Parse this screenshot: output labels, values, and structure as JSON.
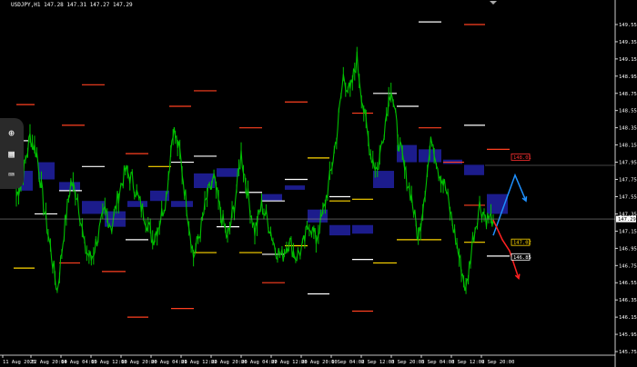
{
  "symbol_line": "USDJPY,H1  147.28 147.31 147.27 147.29",
  "colors": {
    "background": "#000000",
    "candles": "#00c000",
    "axis": "#ffffff",
    "blue_box": "#1c1c8c",
    "blue_arrow": "#1e90ff",
    "red_arrow": "#ff2020"
  },
  "toolbar": [
    {
      "name": "zoom-icon",
      "glyph": "⊕"
    },
    {
      "name": "grid-icon",
      "glyph": "▦"
    },
    {
      "name": "keyboard-icon",
      "glyph": "⌨"
    }
  ],
  "chart_data": {
    "type": "line",
    "title": "",
    "xlabel": "",
    "ylabel": "",
    "price_labels": [
      "149.55",
      "149.35",
      "149.15",
      "148.95",
      "148.75",
      "148.55",
      "148.35",
      "148.15",
      "147.95",
      "147.75",
      "147.55",
      "147.35",
      "147.15",
      "146.95",
      "146.75",
      "146.55",
      "146.35",
      "146.15",
      "145.95",
      "145.75"
    ],
    "price_range": [
      145.7,
      149.6
    ],
    "time_labels": [
      "11 Aug 2025",
      "12 Aug 20:00",
      "14 Aug 04:00",
      "15 Aug 12:00",
      "18 Aug 20:00",
      "20 Aug 04:00",
      "21 Aug 12:00",
      "22 Aug 20:00",
      "26 Aug 04:00",
      "27 Aug 12:00",
      "28 Aug 20:00",
      "1 Sep 04:00",
      "2 Sep 12:00",
      "3 Sep 20:00",
      "5 Sep 04:00",
      "8 Sep 12:00",
      "9 Sep 20:00"
    ],
    "current_price": {
      "value": 147.29,
      "label": "147.29"
    },
    "marker_labels": [
      {
        "value": 148.01,
        "label": "148.01",
        "color": "#ff3030"
      },
      {
        "value": 147.02,
        "label": "147.02",
        "color": "#ffd700"
      },
      {
        "value": 146.85,
        "label": "146.85",
        "color": "#ffffff"
      }
    ],
    "series": [
      {
        "closes": [
          147.55,
          147.82,
          148.25,
          148.05,
          147.45,
          146.95,
          146.45,
          147.15,
          147.72,
          147.55,
          146.95,
          146.82,
          147.1,
          147.38,
          147.2,
          147.58,
          147.85,
          147.75,
          147.5,
          147.3,
          147.05,
          147.25,
          147.55,
          148.35,
          148.05,
          147.45,
          146.85,
          147.15,
          147.55,
          147.75,
          147.35,
          147.05,
          147.45,
          148.05,
          147.55,
          147.15,
          147.45,
          147.25,
          146.95,
          146.85,
          147.05,
          146.85,
          146.95,
          147.25,
          147.05,
          147.35,
          147.75,
          148.25,
          148.95,
          148.75,
          149.15,
          148.55,
          148.05,
          147.85,
          148.35,
          148.85,
          148.25,
          147.85,
          147.55,
          147.05,
          147.65,
          148.25,
          147.85,
          147.65,
          147.25,
          146.85,
          146.45,
          147.05,
          147.45,
          147.3,
          147.29
        ]
      }
    ],
    "levels": [
      {
        "v": 148.2,
        "x0": 18,
        "x1": 32,
        "c": "#ffffff"
      },
      {
        "v": 148.62,
        "x0": 18,
        "x1": 38,
        "c": "#ff4020"
      },
      {
        "v": 147.35,
        "x0": 38,
        "x1": 63,
        "c": "#ffffff"
      },
      {
        "v": 146.72,
        "x0": 15,
        "x1": 38,
        "c": "#ffd700"
      },
      {
        "v": 148.38,
        "x0": 68,
        "x1": 93,
        "c": "#ff4020"
      },
      {
        "v": 147.62,
        "x0": 65,
        "x1": 90,
        "c": "#ffffff"
      },
      {
        "v": 146.78,
        "x0": 65,
        "x1": 88,
        "c": "#ff4020"
      },
      {
        "v": 148.85,
        "x0": 90,
        "x1": 115,
        "c": "#ff4020"
      },
      {
        "v": 147.9,
        "x0": 90,
        "x1": 115,
        "c": "#ffffff"
      },
      {
        "v": 146.68,
        "x0": 112,
        "x1": 138,
        "c": "#ff4020"
      },
      {
        "v": 147.05,
        "x0": 138,
        "x1": 163,
        "c": "#ffffff"
      },
      {
        "v": 148.05,
        "x0": 138,
        "x1": 163,
        "c": "#ff4020"
      },
      {
        "v": 147.9,
        "x0": 163,
        "x1": 188,
        "c": "#ffd700"
      },
      {
        "v": 146.15,
        "x0": 140,
        "x1": 163,
        "c": "#ff4020"
      },
      {
        "v": 147.95,
        "x0": 188,
        "x1": 213,
        "c": "#ffffff"
      },
      {
        "v": 148.6,
        "x0": 186,
        "x1": 210,
        "c": "#ff4020"
      },
      {
        "v": 146.25,
        "x0": 188,
        "x1": 213,
        "c": "#ff4020"
      },
      {
        "v": 148.02,
        "x0": 213,
        "x1": 238,
        "c": "#ffffff"
      },
      {
        "v": 148.78,
        "x0": 213,
        "x1": 238,
        "c": "#ff4020"
      },
      {
        "v": 146.9,
        "x0": 213,
        "x1": 238,
        "c": "#ffd700"
      },
      {
        "v": 147.2,
        "x0": 238,
        "x1": 263,
        "c": "#ffffff"
      },
      {
        "v": 148.35,
        "x0": 263,
        "x1": 288,
        "c": "#ff4020"
      },
      {
        "v": 147.6,
        "x0": 263,
        "x1": 288,
        "c": "#ffffff"
      },
      {
        "v": 146.9,
        "x0": 263,
        "x1": 288,
        "c": "#ffd700"
      },
      {
        "v": 147.5,
        "x0": 288,
        "x1": 313,
        "c": "#ffffff"
      },
      {
        "v": 146.55,
        "x0": 288,
        "x1": 313,
        "c": "#ff4020"
      },
      {
        "v": 148.65,
        "x0": 313,
        "x1": 338,
        "c": "#ff4020"
      },
      {
        "v": 147.75,
        "x0": 313,
        "x1": 338,
        "c": "#ffffff"
      },
      {
        "v": 146.88,
        "x0": 288,
        "x1": 313,
        "c": "#ffffff"
      },
      {
        "v": 146.98,
        "x0": 313,
        "x1": 338,
        "c": "#ffd700"
      },
      {
        "v": 148.0,
        "x0": 338,
        "x1": 362,
        "c": "#ffd700"
      },
      {
        "v": 146.42,
        "x0": 338,
        "x1": 362,
        "c": "#ffffff"
      },
      {
        "v": 147.55,
        "x0": 362,
        "x1": 385,
        "c": "#ffffff"
      },
      {
        "v": 147.5,
        "x0": 362,
        "x1": 385,
        "c": "#ffd700"
      },
      {
        "v": 146.22,
        "x0": 387,
        "x1": 410,
        "c": "#ff4020"
      },
      {
        "v": 148.52,
        "x0": 387,
        "x1": 410,
        "c": "#ff4020"
      },
      {
        "v": 146.82,
        "x0": 387,
        "x1": 410,
        "c": "#ffffff"
      },
      {
        "v": 147.52,
        "x0": 387,
        "x1": 410,
        "c": "#ffd700"
      },
      {
        "v": 148.75,
        "x0": 410,
        "x1": 436,
        "c": "#ffffff"
      },
      {
        "v": 146.78,
        "x0": 410,
        "x1": 436,
        "c": "#ffd700"
      },
      {
        "v": 148.6,
        "x0": 436,
        "x1": 460,
        "c": "#ffffff"
      },
      {
        "v": 148.35,
        "x0": 460,
        "x1": 485,
        "c": "#ff4020"
      },
      {
        "v": 147.05,
        "x0": 436,
        "x1": 460,
        "c": "#ffd700"
      },
      {
        "v": 149.58,
        "x0": 460,
        "x1": 485,
        "c": "#ffffff"
      },
      {
        "v": 147.05,
        "x0": 460,
        "x1": 485,
        "c": "#ffd700"
      },
      {
        "v": 149.55,
        "x0": 510,
        "x1": 533,
        "c": "#ff4020"
      },
      {
        "v": 148.38,
        "x0": 510,
        "x1": 533,
        "c": "#ffffff"
      },
      {
        "v": 147.95,
        "x0": 487,
        "x1": 510,
        "c": "#ff4020"
      },
      {
        "v": 148.1,
        "x0": 535,
        "x1": 560,
        "c": "#ff4020"
      },
      {
        "v": 147.02,
        "x0": 510,
        "x1": 533,
        "c": "#ffd700"
      },
      {
        "v": 146.86,
        "x0": 535,
        "x1": 560,
        "c": "#ffffff"
      },
      {
        "v": 147.45,
        "x0": 510,
        "x1": 533,
        "c": "#ff4020"
      }
    ],
    "zones": [
      {
        "x0": 20,
        "x1": 36,
        "v0": 147.85,
        "v1": 147.62
      },
      {
        "x0": 42,
        "x1": 60,
        "v0": 147.95,
        "v1": 147.75
      },
      {
        "x0": 65,
        "x1": 88,
        "v0": 147.72,
        "v1": 147.62
      },
      {
        "x0": 90,
        "x1": 115,
        "v0": 147.5,
        "v1": 147.35
      },
      {
        "x0": 115,
        "x1": 138,
        "v0": 147.38,
        "v1": 147.2
      },
      {
        "x0": 140,
        "x1": 162,
        "v0": 147.5,
        "v1": 147.43
      },
      {
        "x0": 165,
        "x1": 186,
        "v0": 147.62,
        "v1": 147.5
      },
      {
        "x0": 188,
        "x1": 212,
        "v0": 147.5,
        "v1": 147.43
      },
      {
        "x0": 213,
        "x1": 236,
        "v0": 147.82,
        "v1": 147.65
      },
      {
        "x0": 238,
        "x1": 262,
        "v0": 147.88,
        "v1": 147.78
      },
      {
        "x0": 288,
        "x1": 310,
        "v0": 147.58,
        "v1": 147.5
      },
      {
        "x0": 313,
        "x1": 335,
        "v0": 147.68,
        "v1": 147.63
      },
      {
        "x0": 338,
        "x1": 360,
        "v0": 147.4,
        "v1": 147.25
      },
      {
        "x0": 362,
        "x1": 385,
        "v0": 147.22,
        "v1": 147.1
      },
      {
        "x0": 387,
        "x1": 410,
        "v0": 147.22,
        "v1": 147.12
      },
      {
        "x0": 410,
        "x1": 433,
        "v0": 147.85,
        "v1": 147.65
      },
      {
        "x0": 436,
        "x1": 458,
        "v0": 148.15,
        "v1": 147.95
      },
      {
        "x0": 460,
        "x1": 485,
        "v0": 148.1,
        "v1": 147.95
      },
      {
        "x0": 487,
        "x1": 508,
        "v0": 147.98,
        "v1": 147.93
      },
      {
        "x0": 510,
        "x1": 532,
        "v0": 147.92,
        "v1": 147.8
      },
      {
        "x0": 535,
        "x1": 558,
        "v0": 147.58,
        "v1": 147.35
      }
    ],
    "forecast": [
      {
        "color": "#1e90ff",
        "points": [
          [
            542,
            147.1
          ],
          [
            566,
            147.8
          ],
          [
            578,
            147.5
          ]
        ]
      },
      {
        "color": "#ff2020",
        "points": [
          [
            542,
            147.28
          ],
          [
            552,
            147.05
          ],
          [
            560,
            146.92
          ],
          [
            570,
            146.6
          ]
        ]
      }
    ]
  }
}
